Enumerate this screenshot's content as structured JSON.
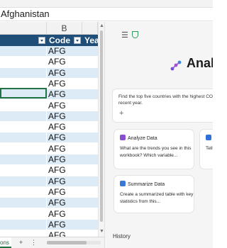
{
  "formula_bar": {
    "value": "Afghanistan"
  },
  "sheet": {
    "column_letters": [
      "B"
    ],
    "headers": {
      "b": "Code",
      "c": "Year"
    },
    "rows": [
      {
        "code": "AFG",
        "band": "band"
      },
      {
        "code": "AFG",
        "band": "plain"
      },
      {
        "code": "AFG",
        "band": "band"
      },
      {
        "code": "AFG",
        "band": "plain"
      },
      {
        "code": "AFG",
        "band": "band"
      },
      {
        "code": "AFG",
        "band": "plain"
      },
      {
        "code": "AFG",
        "band": "band"
      },
      {
        "code": "AFG",
        "band": "plain"
      },
      {
        "code": "AFG",
        "band": "band"
      },
      {
        "code": "AFG",
        "band": "plain"
      },
      {
        "code": "AFG",
        "band": "band"
      },
      {
        "code": "AFG",
        "band": "plain"
      },
      {
        "code": "AFG",
        "band": "band"
      },
      {
        "code": "AFG",
        "band": "plain"
      },
      {
        "code": "AFG",
        "band": "band"
      },
      {
        "code": "AFG",
        "band": "plain"
      },
      {
        "code": "AFG",
        "band": "band"
      },
      {
        "code": "AFG",
        "band": "plain"
      }
    ]
  },
  "sheetbar": {
    "tab_label": "ons",
    "add_label": "+",
    "menu_label": "⋮"
  },
  "copilot": {
    "hero_title": "Analy",
    "prompt_text": "Find the top five countries with the highest CO recent year.",
    "cards": [
      {
        "title": "Analyze Data",
        "body": "What are the trends you see in this workbook? Which variable...",
        "icon_color": "#8a4fd1"
      },
      {
        "title": "Tell",
        "body": "Tell the c",
        "icon_color": "#2f6fd6"
      },
      {
        "title": "Summarize Data",
        "body": "Create a summarized table with key statistics from this...",
        "icon_color": "#3a78d8"
      }
    ],
    "history_label": "History"
  },
  "colors": {
    "header_fill": "#1f4e78",
    "band_fill": "#ddebf7",
    "selection": "#217346"
  },
  "icons": [
    "menu-icon",
    "shield-icon",
    "copilot-logo-icon",
    "plus-icon",
    "analyze-icon",
    "summarize-icon",
    "filter-icon"
  ]
}
